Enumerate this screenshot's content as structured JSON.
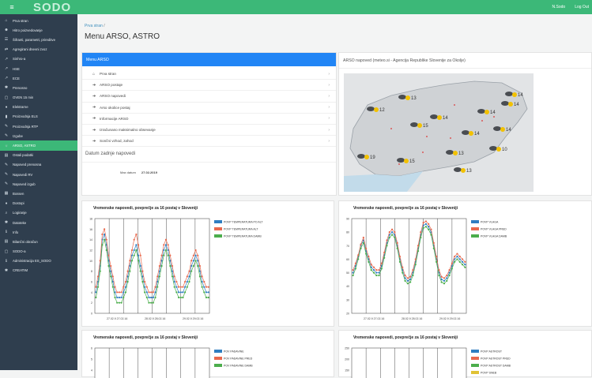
{
  "topbar": {
    "brand": "SODO",
    "user": "N.Sodo",
    "logout": "Log Out"
  },
  "sidebar": {
    "items": [
      {
        "icon": "home-icon",
        "glyph": "⌂",
        "label": "Prva stran",
        "active": false
      },
      {
        "icon": "users-icon",
        "glyph": "☻",
        "label": "Hitro poizvedovanje",
        "active": false
      },
      {
        "icon": "list-icon",
        "glyph": "☰",
        "label": "Šifranti, parametri, prireditve",
        "active": false
      },
      {
        "icon": "exchange-icon",
        "glyph": "⇄",
        "label": "Agregirani dnevni zvoz",
        "active": false
      },
      {
        "icon": "link-icon",
        "glyph": "↗",
        "label": "Sinhro-a",
        "active": false
      },
      {
        "icon": "link-icon",
        "glyph": "↗",
        "label": "HSE",
        "active": false
      },
      {
        "icon": "link-icon",
        "glyph": "↗",
        "label": "ECE",
        "active": false
      },
      {
        "icon": "gear-icon",
        "glyph": "✱",
        "label": "Prenosno",
        "active": false
      },
      {
        "icon": "doc-icon",
        "glyph": "▢",
        "label": "OVEN 15 min",
        "active": false
      },
      {
        "icon": "pin-icon",
        "glyph": "♦",
        "label": "Elektrarne",
        "active": false
      },
      {
        "icon": "chart-icon",
        "glyph": "▮",
        "label": "Proizvodnja ELS",
        "active": false
      },
      {
        "icon": "plug-icon",
        "glyph": "✎",
        "label": "Proizvodnja RTP",
        "active": false
      },
      {
        "icon": "plug-icon",
        "glyph": "✎",
        "label": "Izgube",
        "active": false
      },
      {
        "icon": "sun-icon",
        "glyph": "☼",
        "label": "ARSO, ASTRO",
        "active": true
      },
      {
        "icon": "table-icon",
        "glyph": "▤",
        "label": "Ostali podatki",
        "active": false
      },
      {
        "icon": "plug-icon",
        "glyph": "✎",
        "label": "Napoved prenosna",
        "active": false
      },
      {
        "icon": "plug-icon",
        "glyph": "✎",
        "label": "Napovedi RV",
        "active": false
      },
      {
        "icon": "plug-icon",
        "glyph": "✎",
        "label": "Napoved izgub",
        "active": false
      },
      {
        "icon": "bolt-icon",
        "glyph": "▦",
        "label": "Bossen",
        "active": false
      },
      {
        "icon": "diamond-icon",
        "glyph": "♦",
        "label": "Dostopi",
        "active": false
      },
      {
        "icon": "search-icon",
        "glyph": "⌕",
        "label": "Logiranje",
        "active": false
      },
      {
        "icon": "gear-icon",
        "glyph": "✱",
        "label": "Datoteke",
        "active": false
      },
      {
        "icon": "info-icon",
        "glyph": "ℹ",
        "label": "Info",
        "active": false
      },
      {
        "icon": "table-icon",
        "glyph": "▤",
        "label": "Bilančni obračun",
        "active": false
      },
      {
        "icon": "doc-icon",
        "glyph": "▢",
        "label": "SODO-a",
        "active": false
      },
      {
        "icon": "info-icon",
        "glyph": "ℹ",
        "label": "Administracija ES_SODO",
        "active": false
      },
      {
        "icon": "gear-icon",
        "glyph": "✱",
        "label": "CREATIM",
        "active": false
      }
    ]
  },
  "breadcrumb": {
    "home": "Prva stran",
    "sep": "/"
  },
  "page_title": "Menu ARSO, ASTRO",
  "menu_panel": {
    "title": "Menu ARSO",
    "items": [
      {
        "icon": "home-icon",
        "glyph": "⌂",
        "label": "Prva stran"
      },
      {
        "icon": "arrow-icon",
        "glyph": "➔",
        "label": "ARSO postaje"
      },
      {
        "icon": "arrow-icon",
        "glyph": "➔",
        "label": "ARSO napovedi"
      },
      {
        "icon": "arrow-icon",
        "glyph": "➔",
        "label": "Arso okolice postaj"
      },
      {
        "icon": "arrow-icon",
        "glyph": "➔",
        "label": "Informacije ARSO"
      },
      {
        "icon": "arrow-icon",
        "glyph": "➔",
        "label": "Izračunano maksimalno obsevanje"
      },
      {
        "icon": "arrow-icon",
        "glyph": "➔",
        "label": "Sončni vzhod, zahod"
      }
    ],
    "datum_title": "Datum zadnje napovedi",
    "datum_label": "Max datum",
    "datum_value": "27.02.2019"
  },
  "map_panel": {
    "title": "ARSO napoved (meteo.si - Agencija Republike Slovenije za Okolje)",
    "temps": [
      "14",
      "13",
      "12",
      "14",
      "14",
      "14",
      "15",
      "14",
      "14",
      "10",
      "19",
      "15",
      "13",
      "13"
    ]
  },
  "charts": [
    {
      "title": "Vremenske napovedi, povprečje za 16 postaj v Sloveniji",
      "legend": [
        "POVP TEMPERATURA PO ALT",
        "POVP TEMPERATURA ALT",
        "POVP TEMPERATURA DAMB"
      ],
      "colors": [
        "#2f7ec1",
        "#e8694d",
        "#4cae4c"
      ],
      "yticks": [
        "18",
        "16",
        "14",
        "12",
        "10",
        "8",
        "6",
        "4",
        "2",
        "0"
      ],
      "xticks": [
        "27.02.9 27.02.16",
        "28.02.9 28.02.16",
        "29.02.9 29.02.16"
      ],
      "series": [
        [
          4,
          6,
          9,
          14,
          15,
          13,
          10,
          8,
          6,
          4,
          3,
          3,
          3,
          4,
          5,
          7,
          9,
          11,
          12,
          13,
          11,
          9,
          7,
          5,
          4,
          3,
          3,
          3,
          4,
          6,
          8,
          10,
          12,
          13,
          12,
          10,
          8,
          6,
          5,
          4,
          4,
          4,
          5,
          6,
          7,
          9,
          10,
          11,
          10,
          8,
          6,
          5,
          4,
          4
        ],
        [
          5,
          7,
          10,
          15,
          16,
          14,
          11,
          9,
          7,
          5,
          4,
          4,
          4,
          5,
          6,
          8,
          10,
          12,
          14,
          15,
          13,
          11,
          8,
          6,
          5,
          4,
          4,
          4,
          5,
          7,
          9,
          11,
          13,
          14,
          13,
          11,
          9,
          7,
          6,
          5,
          5,
          5,
          6,
          7,
          8,
          10,
          11,
          12,
          11,
          9,
          7,
          6,
          5,
          5
        ],
        [
          3,
          5,
          8,
          13,
          14,
          12,
          9,
          7,
          5,
          3,
          2,
          2,
          2,
          3,
          4,
          6,
          8,
          10,
          11,
          12,
          10,
          8,
          6,
          4,
          3,
          2,
          2,
          2,
          3,
          5,
          7,
          9,
          11,
          12,
          11,
          9,
          7,
          5,
          4,
          3,
          3,
          3,
          4,
          5,
          6,
          8,
          9,
          10,
          9,
          7,
          5,
          4,
          3,
          3
        ]
      ]
    },
    {
      "title": "Vremenske napovedi, povprečje za 16 postaj v Sloveniji",
      "legend": [
        "POVP VLAGA",
        "POVP VLAGA PRED",
        "POVP VLAGA DAMB"
      ],
      "colors": [
        "#2f7ec1",
        "#e8694d",
        "#4cae4c"
      ],
      "yticks": [
        "90",
        "80",
        "70",
        "60",
        "50",
        "40",
        "30",
        "20"
      ],
      "xticks": [
        "27.02.9 27.02.16",
        "28.02.9 28.02.16",
        "29.02.9 29.02.16"
      ],
      "series": [
        [
          50,
          55,
          62,
          70,
          74,
          66,
          60,
          54,
          52,
          50,
          50,
          55,
          63,
          72,
          78,
          80,
          78,
          70,
          60,
          52,
          46,
          44,
          45,
          50,
          58,
          68,
          78,
          85,
          86,
          84,
          80,
          70,
          60,
          50,
          45,
          44,
          46,
          50,
          55,
          60,
          62,
          60,
          58,
          56
        ],
        [
          52,
          57,
          63,
          71,
          76,
          68,
          62,
          56,
          54,
          52,
          52,
          57,
          65,
          74,
          80,
          82,
          80,
          72,
          62,
          54,
          48,
          46,
          47,
          52,
          60,
          70,
          80,
          87,
          88,
          86,
          82,
          72,
          62,
          52,
          47,
          46,
          48,
          52,
          57,
          62,
          64,
          62,
          60,
          58
        ],
        [
          48,
          53,
          60,
          68,
          72,
          64,
          58,
          52,
          50,
          48,
          48,
          53,
          61,
          70,
          76,
          78,
          76,
          68,
          58,
          50,
          44,
          42,
          43,
          48,
          56,
          66,
          76,
          83,
          84,
          82,
          78,
          68,
          58,
          48,
          43,
          42,
          44,
          48,
          53,
          58,
          60,
          58,
          56,
          54
        ]
      ]
    },
    {
      "title": "Vremenske napovedi, povprečje za 16 postaj v Sloveniji",
      "legend": [
        "POV PADAVINE",
        "POV PADAVINE PRED",
        "POV PADAVINE DAMB"
      ],
      "colors": [
        "#2f7ec1",
        "#e8694d",
        "#4cae4c"
      ],
      "yticks": [
        "6",
        "5",
        "4",
        "3"
      ],
      "xticks": [],
      "series": [
        [
          0,
          0,
          0,
          0,
          0,
          0,
          0,
          0,
          0,
          0,
          0,
          0,
          0,
          0,
          0,
          0,
          0,
          0,
          0,
          0,
          0,
          0,
          0,
          0
        ],
        [
          0,
          0,
          0,
          0,
          0,
          0,
          0,
          0,
          0,
          0,
          0,
          0,
          0,
          0,
          0,
          0,
          0,
          0,
          0,
          0,
          0,
          0,
          0,
          0
        ],
        [
          0,
          0,
          0,
          0,
          0,
          0,
          0,
          0,
          0,
          0,
          0,
          0,
          0,
          0,
          0,
          0,
          0,
          0,
          0,
          0,
          0,
          0,
          0,
          0
        ]
      ]
    },
    {
      "title": "Vremenske napovedi, povprečje za 16 postaj v Sloveniji",
      "legend": [
        "POVP ASTROST",
        "POVP ASTROST PRED",
        "POVP ASTROST DAMB",
        "POVP SNEB",
        "POVP SNEB PRED"
      ],
      "colors": [
        "#2f7ec1",
        "#e8694d",
        "#4cae4c",
        "#e0c234",
        "#88c5e8"
      ],
      "yticks": [
        "250",
        "200",
        "150",
        "100"
      ],
      "xticks": [],
      "series": [
        [
          0,
          0,
          0,
          0,
          0,
          0,
          0,
          0,
          0,
          0,
          0,
          0,
          0,
          0,
          0,
          0,
          0,
          0,
          0,
          0
        ],
        [
          0,
          0,
          0,
          0,
          0,
          0,
          0,
          0,
          0,
          0,
          0,
          0,
          0,
          0,
          0,
          0,
          0,
          0,
          0,
          0
        ],
        [
          0,
          0,
          0,
          0,
          0,
          0,
          0,
          0,
          0,
          0,
          0,
          0,
          0,
          0,
          0,
          0,
          0,
          0,
          0,
          0
        ]
      ]
    }
  ]
}
